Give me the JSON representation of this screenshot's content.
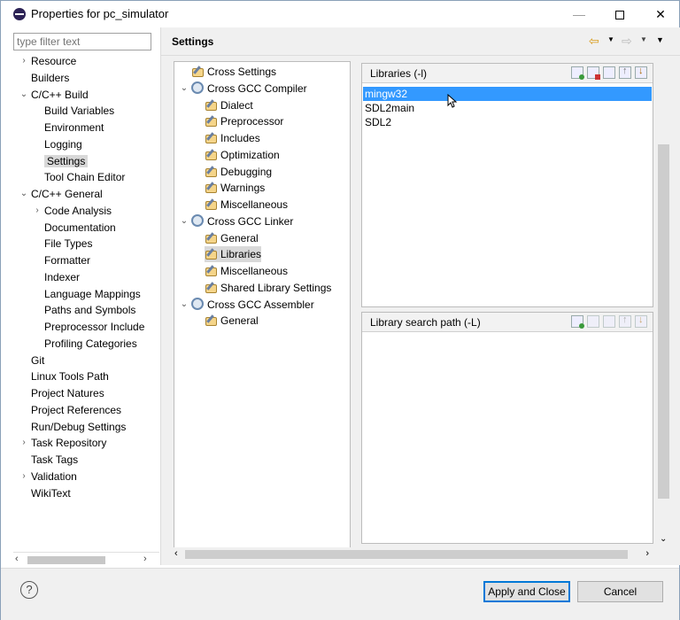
{
  "window": {
    "title": "Properties for pc_simulator"
  },
  "filter": {
    "placeholder": "type filter text"
  },
  "left_tree": [
    {
      "label": "Resource",
      "indent": 1,
      "chevron": "›"
    },
    {
      "label": "Builders",
      "indent": 1,
      "chevron": ""
    },
    {
      "label": "C/C++ Build",
      "indent": 1,
      "chevron": "⌄"
    },
    {
      "label": "Build Variables",
      "indent": 2,
      "chevron": ""
    },
    {
      "label": "Environment",
      "indent": 2,
      "chevron": ""
    },
    {
      "label": "Logging",
      "indent": 2,
      "chevron": ""
    },
    {
      "label": "Settings",
      "indent": 2,
      "chevron": "",
      "selected": true
    },
    {
      "label": "Tool Chain Editor",
      "indent": 2,
      "chevron": ""
    },
    {
      "label": "C/C++ General",
      "indent": 1,
      "chevron": "⌄"
    },
    {
      "label": "Code Analysis",
      "indent": 2,
      "chevron": "›"
    },
    {
      "label": "Documentation",
      "indent": 2,
      "chevron": ""
    },
    {
      "label": "File Types",
      "indent": 2,
      "chevron": ""
    },
    {
      "label": "Formatter",
      "indent": 2,
      "chevron": ""
    },
    {
      "label": "Indexer",
      "indent": 2,
      "chevron": ""
    },
    {
      "label": "Language Mappings",
      "indent": 2,
      "chevron": ""
    },
    {
      "label": "Paths and Symbols",
      "indent": 2,
      "chevron": ""
    },
    {
      "label": "Preprocessor Include",
      "indent": 2,
      "chevron": ""
    },
    {
      "label": "Profiling Categories",
      "indent": 2,
      "chevron": ""
    },
    {
      "label": "Git",
      "indent": 1,
      "chevron": ""
    },
    {
      "label": "Linux Tools Path",
      "indent": 1,
      "chevron": ""
    },
    {
      "label": "Project Natures",
      "indent": 1,
      "chevron": ""
    },
    {
      "label": "Project References",
      "indent": 1,
      "chevron": ""
    },
    {
      "label": "Run/Debug Settings",
      "indent": 1,
      "chevron": ""
    },
    {
      "label": "Task Repository",
      "indent": 1,
      "chevron": "›"
    },
    {
      "label": "Task Tags",
      "indent": 1,
      "chevron": ""
    },
    {
      "label": "Validation",
      "indent": 1,
      "chevron": "›"
    },
    {
      "label": "WikiText",
      "indent": 1,
      "chevron": ""
    }
  ],
  "settings": {
    "title": "Settings"
  },
  "tool_tree": [
    {
      "label": "Cross Settings",
      "indent": 1,
      "icon": "tool-icon",
      "chevron": ""
    },
    {
      "label": "Cross GCC Compiler",
      "indent": 1,
      "icon": "gear-icon",
      "chevron": "⌄"
    },
    {
      "label": "Dialect",
      "indent": 2,
      "icon": "tool-icon",
      "chevron": ""
    },
    {
      "label": "Preprocessor",
      "indent": 2,
      "icon": "tool-icon",
      "chevron": ""
    },
    {
      "label": "Includes",
      "indent": 2,
      "icon": "tool-icon",
      "chevron": ""
    },
    {
      "label": "Optimization",
      "indent": 2,
      "icon": "tool-icon",
      "chevron": ""
    },
    {
      "label": "Debugging",
      "indent": 2,
      "icon": "tool-icon",
      "chevron": ""
    },
    {
      "label": "Warnings",
      "indent": 2,
      "icon": "tool-icon",
      "chevron": ""
    },
    {
      "label": "Miscellaneous",
      "indent": 2,
      "icon": "tool-icon",
      "chevron": ""
    },
    {
      "label": "Cross GCC Linker",
      "indent": 1,
      "icon": "gear-icon",
      "chevron": "⌄"
    },
    {
      "label": "General",
      "indent": 2,
      "icon": "tool-icon",
      "chevron": ""
    },
    {
      "label": "Libraries",
      "indent": 2,
      "icon": "tool-icon",
      "chevron": "",
      "selected": true
    },
    {
      "label": "Miscellaneous",
      "indent": 2,
      "icon": "tool-icon",
      "chevron": ""
    },
    {
      "label": "Shared Library Settings",
      "indent": 2,
      "icon": "tool-icon",
      "chevron": ""
    },
    {
      "label": "Cross GCC Assembler",
      "indent": 1,
      "icon": "gear-icon",
      "chevron": "⌄"
    },
    {
      "label": "General",
      "indent": 2,
      "icon": "tool-icon",
      "chevron": ""
    }
  ],
  "libraries": {
    "header": "Libraries (-l)",
    "items": [
      "mingw32",
      "SDL2main",
      "SDL2"
    ],
    "selected_index": 0
  },
  "library_search_path": {
    "header": "Library search path (-L)",
    "items": []
  },
  "footer": {
    "help_label": "?",
    "apply_close_label": "Apply and Close",
    "cancel_label": "Cancel"
  },
  "colors": {
    "selection": "#3399ff",
    "primary_border": "#0078d7"
  }
}
